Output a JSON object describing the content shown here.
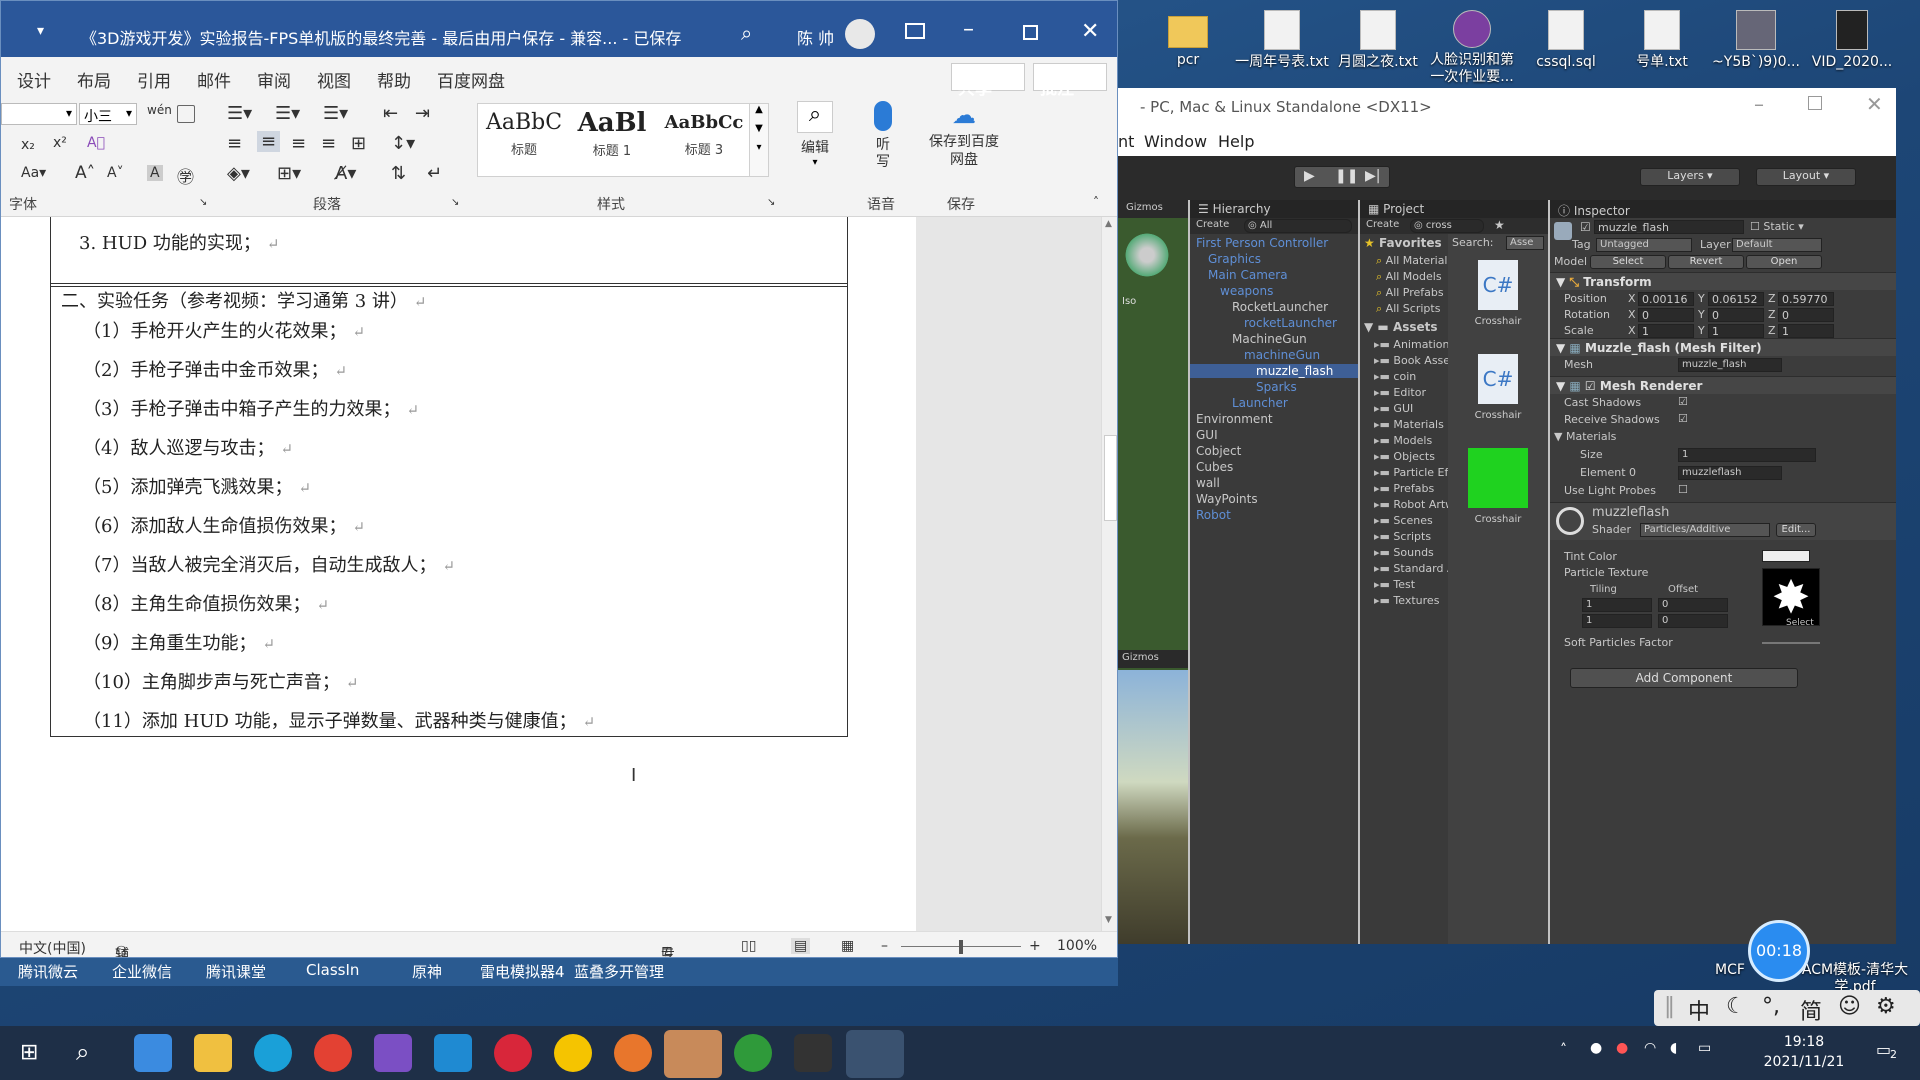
{
  "desktop": {
    "icons": [
      {
        "label": "pcr",
        "kind": "folder"
      },
      {
        "label": "一周年号表.txt",
        "kind": "txt"
      },
      {
        "label": "月圆之夜.txt",
        "kind": "txt"
      },
      {
        "label": "人脸识别和第一次作业要...",
        "kind": "rar"
      },
      {
        "label": "cssql.sql",
        "kind": "txt"
      },
      {
        "label": "号单.txt",
        "kind": "txt"
      },
      {
        "label": "~Y5B`)9)0...",
        "kind": "img"
      },
      {
        "label": "VID_2020...",
        "kind": "vid"
      }
    ],
    "partial_labels": [
      "MCF",
      "ACM模板-清华大学.pdf"
    ]
  },
  "word": {
    "title": "《3D游戏开发》实验报告-FPS单机版的最终完善 - 最后由用户保存 - 兼容... - 已保存",
    "user": "陈 帅",
    "tabs": [
      "设计",
      "布局",
      "引用",
      "邮件",
      "审阅",
      "视图",
      "帮助",
      "百度网盘"
    ],
    "share_label": "共享",
    "comment_label": "批注",
    "font_size": "小三",
    "styles": [
      {
        "preview": "AaBbC",
        "name": "标题"
      },
      {
        "preview": "AaBl",
        "name": "标题 1"
      },
      {
        "preview": "AaBbCc",
        "name": "标题 3"
      }
    ],
    "groups": {
      "font": "字体",
      "paragraph": "段落",
      "styles": "样式",
      "voice": "语音",
      "save": "保存"
    },
    "edit_label": "编辑",
    "dictate_label": "听写",
    "save_baidu_label": "保存到百度网盘",
    "document": {
      "line_hud": "3. HUD 功能的实现；",
      "section2_title": "二、实验任务（参考视频：学习通第 3 讲）",
      "tasks": [
        "（1）手枪开火产生的火花效果；",
        "（2）手枪子弹击中金币效果；",
        "（3）手枪子弹击中箱子产生的力效果；",
        "（4）敌人巡逻与攻击；",
        "（5）添加弹壳飞溅效果；",
        "（6）添加敌人生命值损伤效果；",
        "（7）当敌人被完全消灭后，自动生成敌人；",
        "（8）主角生命值损伤效果；",
        "（9）主角重生功能；",
        "（10）主角脚步声与死亡声音；",
        "（11）添加 HUD 功能，显示子弹数量、武器种类与健康值；"
      ],
      "return_mark": "↵"
    },
    "status": {
      "language": "中文(中国)",
      "accessibility": "辅助功能: 不可用",
      "focus": "专注",
      "zoom": "100%"
    }
  },
  "unity": {
    "title": "- PC, Mac & Linux Standalone <DX11>",
    "menu": [
      "nt",
      "Window",
      "Help"
    ],
    "layers_label": "Layers",
    "layout_label": "Layout",
    "gizmos_label": "Gizmos",
    "iso_label": "Iso",
    "hierarchy": {
      "tab": "Hierarchy",
      "create": "Create",
      "search": "All",
      "items": [
        {
          "label": "First Person Controller",
          "indent": 0,
          "blue": true
        },
        {
          "label": "Graphics",
          "indent": 1,
          "blue": true
        },
        {
          "label": "Main Camera",
          "indent": 1,
          "blue": true
        },
        {
          "label": "weapons",
          "indent": 2,
          "blue": true
        },
        {
          "label": "RocketLauncher",
          "indent": 3,
          "blue": false
        },
        {
          "label": "rocketLauncher",
          "indent": 4,
          "blue": true
        },
        {
          "label": "MachineGun",
          "indent": 3,
          "blue": false
        },
        {
          "label": "machineGun",
          "indent": 4,
          "blue": true
        },
        {
          "label": "muzzle_flash",
          "indent": 5,
          "blue": false,
          "selected": true
        },
        {
          "label": "Sparks",
          "indent": 5,
          "blue": true
        },
        {
          "label": "Launcher",
          "indent": 3,
          "blue": true
        },
        {
          "label": "Environment",
          "indent": 0,
          "blue": false
        },
        {
          "label": "GUI",
          "indent": 0,
          "blue": false
        },
        {
          "label": "Cobject",
          "indent": 0,
          "blue": false
        },
        {
          "label": "Cubes",
          "indent": 0,
          "blue": false
        },
        {
          "label": "wall",
          "indent": 0,
          "blue": false
        },
        {
          "label": "WayPoints",
          "indent": 0,
          "blue": false
        },
        {
          "label": "Robot",
          "indent": 0,
          "blue": true
        }
      ]
    },
    "project": {
      "tab": "Project",
      "create": "Create",
      "search": "cross",
      "search_label": "Search:",
      "search_scope": "Asse",
      "favorites_label": "Favorites",
      "favorites": [
        "All Material",
        "All Models",
        "All Prefabs",
        "All Scripts"
      ],
      "assets_label": "Assets",
      "folders": [
        "Animations",
        "Book Asset",
        "coin",
        "Editor",
        "GUI",
        "Materials",
        "Models",
        "Objects",
        "Particle Effe",
        "Prefabs",
        "Robot Artw",
        "Scenes",
        "Scripts",
        "Sounds",
        "Standard A",
        "Test",
        "Textures"
      ],
      "results": [
        "Crosshair",
        "Crosshair",
        "Crosshair"
      ]
    },
    "inspector": {
      "tab": "Inspector",
      "object_name": "muzzle_flash",
      "static_label": "Static",
      "tag_label": "Tag",
      "tag": "Untagged",
      "layer_label": "Layer",
      "layer": "Default",
      "model_label": "Model",
      "model_buttons": [
        "Select",
        "Revert",
        "Open"
      ],
      "transform": {
        "title": "Transform",
        "rows": [
          {
            "label": "Position",
            "x": "0.00116",
            "y": "0.06152",
            "z": "0.59770"
          },
          {
            "label": "Rotation",
            "x": "0",
            "y": "0",
            "z": "0"
          },
          {
            "label": "Scale",
            "x": "1",
            "y": "1",
            "z": "1"
          }
        ]
      },
      "mesh_filter": {
        "title": "Muzzle_flash (Mesh Filter)",
        "mesh_label": "Mesh",
        "mesh": "muzzle_flash"
      },
      "mesh_renderer": {
        "title": "Mesh Renderer",
        "cast_shadows": "Cast Shadows",
        "receive_shadows": "Receive Shadows",
        "materials": "Materials",
        "size_label": "Size",
        "size": "1",
        "element_label": "Element 0",
        "element": "muzzleflash",
        "light_probes": "Use Light Probes"
      },
      "material": {
        "name": "muzzleflash",
        "shader_label": "Shader",
        "shader": "Particles/Additive",
        "edit": "Edit...",
        "tint": "Tint Color",
        "texture": "Particle Texture",
        "tiling": "Tiling",
        "offset": "Offset",
        "tx": "1",
        "ty": "1",
        "ox": "0",
        "oy": "0",
        "select": "Select",
        "soft": "Soft Particles Factor"
      },
      "add_component": "Add Component"
    }
  },
  "shortcuts": [
    "腾讯微云",
    "企业微信",
    "腾讯课堂",
    "ClassIn",
    "原神",
    "雷电模拟器4",
    "蓝叠多开管理"
  ],
  "timer": "00:18",
  "ime": {
    "chars": [
      "中",
      "简"
    ]
  },
  "clock": {
    "time": "19:18",
    "date": "2021/11/21"
  },
  "notifications": "2",
  "colors": {
    "word_blue": "#2b579a",
    "unity_dark": "#3a3a3a",
    "taskbar": "#1e2f47"
  }
}
